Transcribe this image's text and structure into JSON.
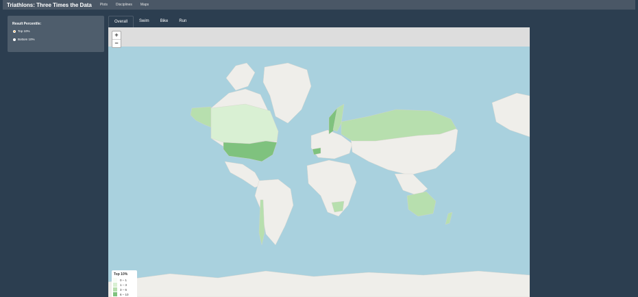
{
  "navbar": {
    "title": "Triathlons: Three Times the Data",
    "links": [
      "Plots",
      "Disciplines",
      "Maps"
    ]
  },
  "sidebar": {
    "label": "Result Percentile:",
    "options": [
      {
        "label": "Top 10%",
        "selected": true
      },
      {
        "label": "Bottom 10%",
        "selected": false
      }
    ]
  },
  "tabs": [
    "Overall",
    "Swim",
    "Bike",
    "Run"
  ],
  "map": {
    "zoom_in": "+",
    "zoom_out": "−",
    "legend": {
      "title": "Top 10%",
      "items": [
        {
          "label": "0 – 1",
          "color": "#f7fcf5"
        },
        {
          "label": "1 – 3",
          "color": "#d9f0d3"
        },
        {
          "label": "3 – 6",
          "color": "#b7dfae"
        },
        {
          "label": "6 – 10",
          "color": "#7fc27e"
        }
      ]
    }
  },
  "colors": {
    "page_bg": "#2c3e50",
    "navbar_bg": "#4a5766",
    "ocean": "#a9d1de",
    "land": "#efeeea",
    "accent": "#f0ad4e"
  }
}
